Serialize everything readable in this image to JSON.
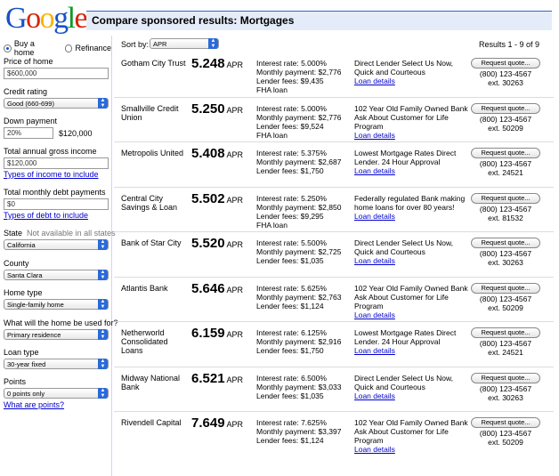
{
  "header": {
    "title": "Compare sponsored results: Mortgages",
    "logo": {
      "letters": [
        "G",
        "o",
        "o",
        "g",
        "l",
        "e"
      ],
      "colors": [
        "#1a52c6",
        "#d62408",
        "#f7b400",
        "#1a52c6",
        "#0a9a26",
        "#d62408"
      ]
    }
  },
  "purpose": {
    "buy_label": "Buy a home",
    "refinance_label": "Refinance",
    "selected": "buy"
  },
  "form": {
    "price": {
      "label": "Price of home",
      "value": "$600,000"
    },
    "credit": {
      "label": "Credit rating",
      "value": "Good (660-699)"
    },
    "down": {
      "label": "Down payment",
      "value": "20%",
      "amount": "$120,000"
    },
    "income": {
      "label": "Total annual gross income",
      "value": "$120,000",
      "link": "Types of income to include"
    },
    "debt": {
      "label": "Total monthly debt payments",
      "value": "$0",
      "link": "Types of debt to include"
    },
    "state": {
      "label": "State",
      "note": "Not available in all states",
      "value": "California"
    },
    "county": {
      "label": "County",
      "value": "Santa Clara"
    },
    "home_type": {
      "label": "Home type",
      "value": "Single-family home"
    },
    "use": {
      "label": "What will the home be used for?",
      "value": "Primary residence"
    },
    "loan_type": {
      "label": "Loan type",
      "value": "30-year fixed"
    },
    "points": {
      "label": "Points",
      "value": "0 points only",
      "link": "What are points?"
    }
  },
  "sort": {
    "label": "Sort by:",
    "value": "APR",
    "count": "Results 1 - 9 of 9"
  },
  "common": {
    "apr_unit": "APR",
    "details_link": "Loan details",
    "quote_button": "Request quote..."
  },
  "results": [
    {
      "name": "Gotham City Trust",
      "apr": "5.248",
      "terms": [
        "Interest rate: 5.000%",
        "Monthly payment: $2,776",
        "Lender fees: $9,435",
        "FHA loan"
      ],
      "desc": "Direct Lender Select Us Now, Quick and Courteous",
      "phone": "(800) 123-4567",
      "ext": "ext. 30263"
    },
    {
      "name": "Smallville Credit Union",
      "apr": "5.250",
      "terms": [
        "Interest rate: 5.000%",
        "Monthly payment: $2,776",
        "Lender fees: $9,524",
        "FHA loan"
      ],
      "desc": "102 Year Old Family Owned Bank Ask About Customer for Life Program",
      "phone": "(800) 123-4567",
      "ext": "ext. 50209"
    },
    {
      "name": "Metropolis United",
      "apr": "5.408",
      "terms": [
        "Interest rate: 5.375%",
        "Monthly payment: $2,687",
        "Lender fees: $1,750"
      ],
      "desc": "Lowest Mortgage Rates Direct Lender. 24 Hour Approval",
      "phone": "(800) 123-4567",
      "ext": "ext. 24521"
    },
    {
      "name": "Central City Savings & Loan",
      "apr": "5.502",
      "terms": [
        "Interest rate: 5.250%",
        "Monthly payment: $2,850",
        "Lender fees: $9,295",
        "FHA loan"
      ],
      "desc": "Federally regulated Bank making home loans for over 80 years!",
      "phone": "(800) 123-4567",
      "ext": "ext. 81532"
    },
    {
      "name": "Bank of Star City",
      "apr": "5.520",
      "terms": [
        "Interest rate: 5.500%",
        "Monthly payment: $2,725",
        "Lender fees: $1,035"
      ],
      "desc": "Direct Lender Select Us Now, Quick and Courteous",
      "phone": "(800) 123-4567",
      "ext": "ext. 30263"
    },
    {
      "name": "Atlantis Bank",
      "apr": "5.646",
      "terms": [
        "Interest rate: 5.625%",
        "Monthly payment: $2,763",
        "Lender fees: $1,124"
      ],
      "desc": "102 Year Old Family Owned Bank Ask About Customer for Life Program",
      "phone": "(800) 123-4567",
      "ext": "ext. 50209"
    },
    {
      "name": "Netherworld Consolidated Loans",
      "apr": "6.159",
      "terms": [
        "Interest rate: 6.125%",
        "Monthly payment: $2,916",
        "Lender fees: $1,750"
      ],
      "desc": "Lowest Mortgage Rates Direct Lender. 24 Hour Approval",
      "phone": "(800) 123-4567",
      "ext": "ext. 24521"
    },
    {
      "name": "Midway National Bank",
      "apr": "6.521",
      "terms": [
        "Interest rate: 6.500%",
        "Monthly payment: $3,033",
        "Lender fees: $1,035"
      ],
      "desc": "Direct Lender Select Us Now, Quick and Courteous",
      "phone": "(800) 123-4567",
      "ext": "ext. 30263"
    },
    {
      "name": "Rivendell Capital",
      "apr": "7.649",
      "terms": [
        "Interest rate: 7.625%",
        "Monthly payment: $3,397",
        "Lender fees: $1,124"
      ],
      "desc": "102 Year Old Family Owned Bank Ask About Customer for Life Program",
      "phone": "(800) 123-4567",
      "ext": "ext. 50209"
    }
  ]
}
